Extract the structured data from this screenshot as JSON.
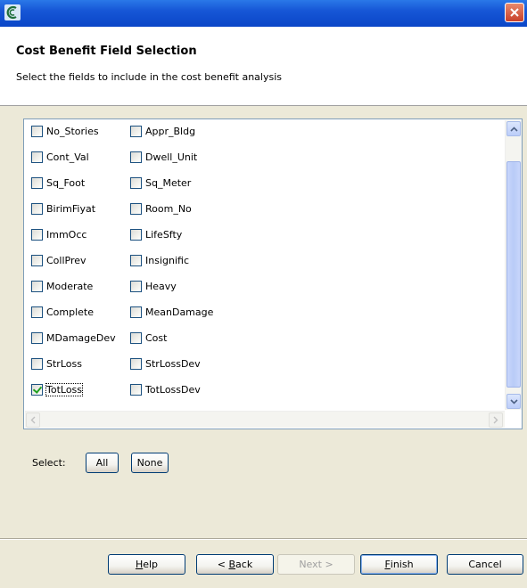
{
  "header": {
    "title": "Cost Benefit Field Selection",
    "description": "Select the fields to include in the cost benefit analysis"
  },
  "fields": {
    "left": [
      {
        "label": "No_Stories",
        "checked": false
      },
      {
        "label": "Cont_Val",
        "checked": false
      },
      {
        "label": "Sq_Foot",
        "checked": false
      },
      {
        "label": "BirimFiyat",
        "checked": false
      },
      {
        "label": "ImmOcc",
        "checked": false
      },
      {
        "label": "CollPrev",
        "checked": false
      },
      {
        "label": "Moderate",
        "checked": false
      },
      {
        "label": "Complete",
        "checked": false
      },
      {
        "label": "MDamageDev",
        "checked": false
      },
      {
        "label": "StrLoss",
        "checked": false
      },
      {
        "label": "TotLoss",
        "checked": true
      }
    ],
    "right": [
      {
        "label": "Appr_Bldg",
        "checked": false
      },
      {
        "label": "Dwell_Unit",
        "checked": false
      },
      {
        "label": "Sq_Meter",
        "checked": false
      },
      {
        "label": "Room_No",
        "checked": false
      },
      {
        "label": "LifeSfty",
        "checked": false
      },
      {
        "label": "Insignific",
        "checked": false
      },
      {
        "label": "Heavy",
        "checked": false
      },
      {
        "label": "MeanDamage",
        "checked": false
      },
      {
        "label": "Cost",
        "checked": false
      },
      {
        "label": "StrLossDev",
        "checked": false
      },
      {
        "label": "TotLossDev",
        "checked": false
      }
    ]
  },
  "select": {
    "label": "Select:",
    "all": "All",
    "none": "None"
  },
  "footer": {
    "help": {
      "mnemonic": "H",
      "rest": "elp"
    },
    "back": {
      "prefix": "< ",
      "mnemonic": "B",
      "rest": "ack"
    },
    "next": "Next >",
    "finish": {
      "mnemonic": "F",
      "rest": "inish"
    },
    "cancel": "Cancel"
  },
  "icons": {
    "app": "app-logo-icon",
    "close": "close-icon",
    "scroll_up": "chevron-up-icon",
    "scroll_down": "chevron-down-icon",
    "scroll_left": "chevron-left-icon",
    "scroll_right": "chevron-right-icon"
  },
  "colors": {
    "titlebar": "#0a46c7",
    "close": "#c8402a",
    "check": "#21a121",
    "panel_bg": "#ece9d8"
  }
}
